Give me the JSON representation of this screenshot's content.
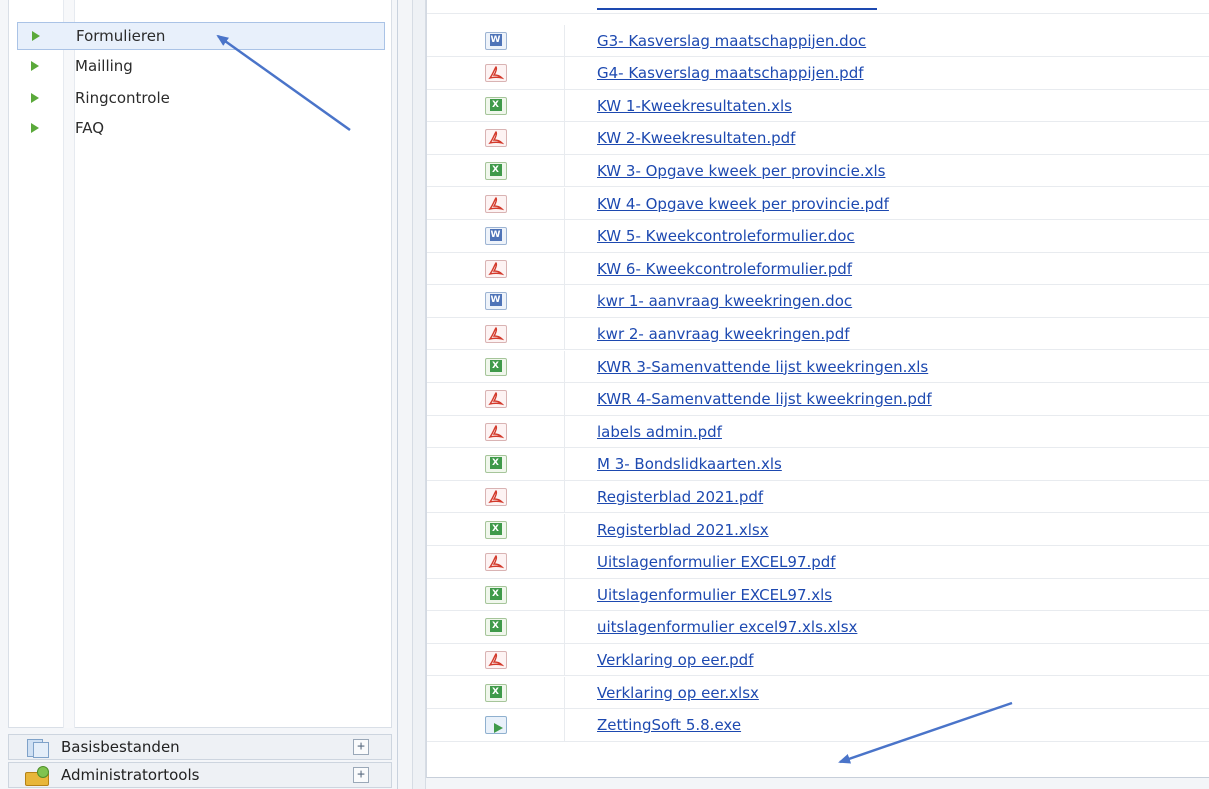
{
  "sidebar": {
    "tree_items": [
      {
        "label": "Formulieren",
        "selected": true
      },
      {
        "label": "Mailling",
        "selected": false
      },
      {
        "label": "Ringcontrole",
        "selected": false
      },
      {
        "label": "FAQ",
        "selected": false
      }
    ],
    "panels": [
      {
        "label": "Basisbestanden",
        "icon": "pages-icon",
        "toggle": "+"
      },
      {
        "label": "Administratortools",
        "icon": "tools-icon",
        "toggle": "+"
      }
    ]
  },
  "files": [
    {
      "name": "G3- Kasverslag maatschappijen.doc",
      "type": "doc"
    },
    {
      "name": "G4- Kasverslag maatschappijen.pdf",
      "type": "pdf"
    },
    {
      "name": "KW 1-Kweekresultaten.xls",
      "type": "xls"
    },
    {
      "name": "KW 2-Kweekresultaten.pdf",
      "type": "pdf"
    },
    {
      "name": "KW 3- Opgave kweek per provincie.xls",
      "type": "xls"
    },
    {
      "name": "KW 4- Opgave kweek per provincie.pdf",
      "type": "pdf"
    },
    {
      "name": "KW 5- Kweekcontroleformulier.doc",
      "type": "doc"
    },
    {
      "name": "KW 6- Kweekcontroleformulier.pdf",
      "type": "pdf"
    },
    {
      "name": "kwr 1- aanvraag kweekringen.doc",
      "type": "doc"
    },
    {
      "name": "kwr 2- aanvraag kweekringen.pdf",
      "type": "pdf"
    },
    {
      "name": "KWR 3-Samenvattende lijst kweekringen.xls",
      "type": "xls"
    },
    {
      "name": "KWR 4-Samenvattende lijst kweekringen.pdf",
      "type": "pdf"
    },
    {
      "name": "labels admin.pdf",
      "type": "pdf"
    },
    {
      "name": "M 3- Bondslidkaarten.xls",
      "type": "xls"
    },
    {
      "name": "Registerblad 2021.pdf",
      "type": "pdf"
    },
    {
      "name": "Registerblad 2021.xlsx",
      "type": "xls"
    },
    {
      "name": "Uitslagenformulier EXCEL97.pdf",
      "type": "pdf"
    },
    {
      "name": "Uitslagenformulier EXCEL97.xls",
      "type": "xls"
    },
    {
      "name": "uitslagenformulier excel97.xls.xlsx",
      "type": "xls"
    },
    {
      "name": "Verklaring op eer.pdf",
      "type": "pdf"
    },
    {
      "name": "Verklaring op eer.xlsx",
      "type": "xls"
    },
    {
      "name": "ZettingSoft 5.8.exe",
      "type": "exe"
    }
  ],
  "colors": {
    "link": "#1d49b0",
    "tree_arrow": "#5aa93a",
    "annotation_arrow": "#4a74c9"
  }
}
